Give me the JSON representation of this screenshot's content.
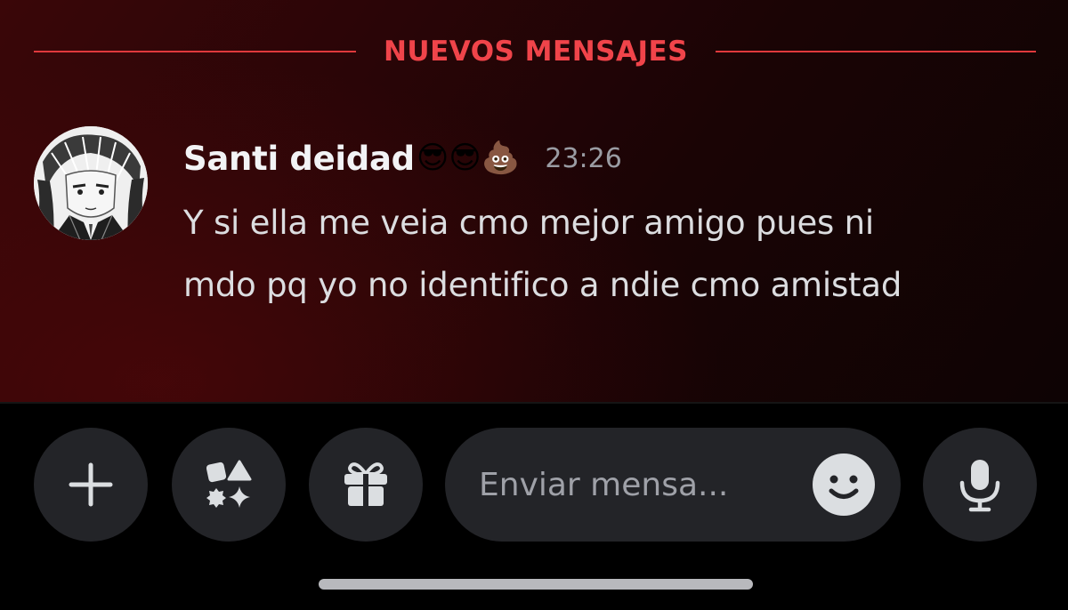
{
  "divider": {
    "label": "NUEVOS MENSAJES",
    "color": "#f0444a"
  },
  "message": {
    "author": "Santi deidad",
    "author_emojis": "😎😎💩",
    "timestamp": "23:26",
    "lines": [
      "Y si ella me veia cmo mejor amigo pues ni",
      "mdo pq yo no identifico a ndie cmo amistad"
    ],
    "avatar_icon": "manga-character-avatar"
  },
  "composer": {
    "placeholder": "Enviar mensa...",
    "buttons": {
      "add": "plus-icon",
      "apps": "apps-icon",
      "gift": "gift-icon",
      "emoji": "smiley-icon",
      "voice": "microphone-icon"
    }
  },
  "colors": {
    "accent": "#f0444a",
    "button_bg": "#232428",
    "icon": "#dbdee1"
  }
}
